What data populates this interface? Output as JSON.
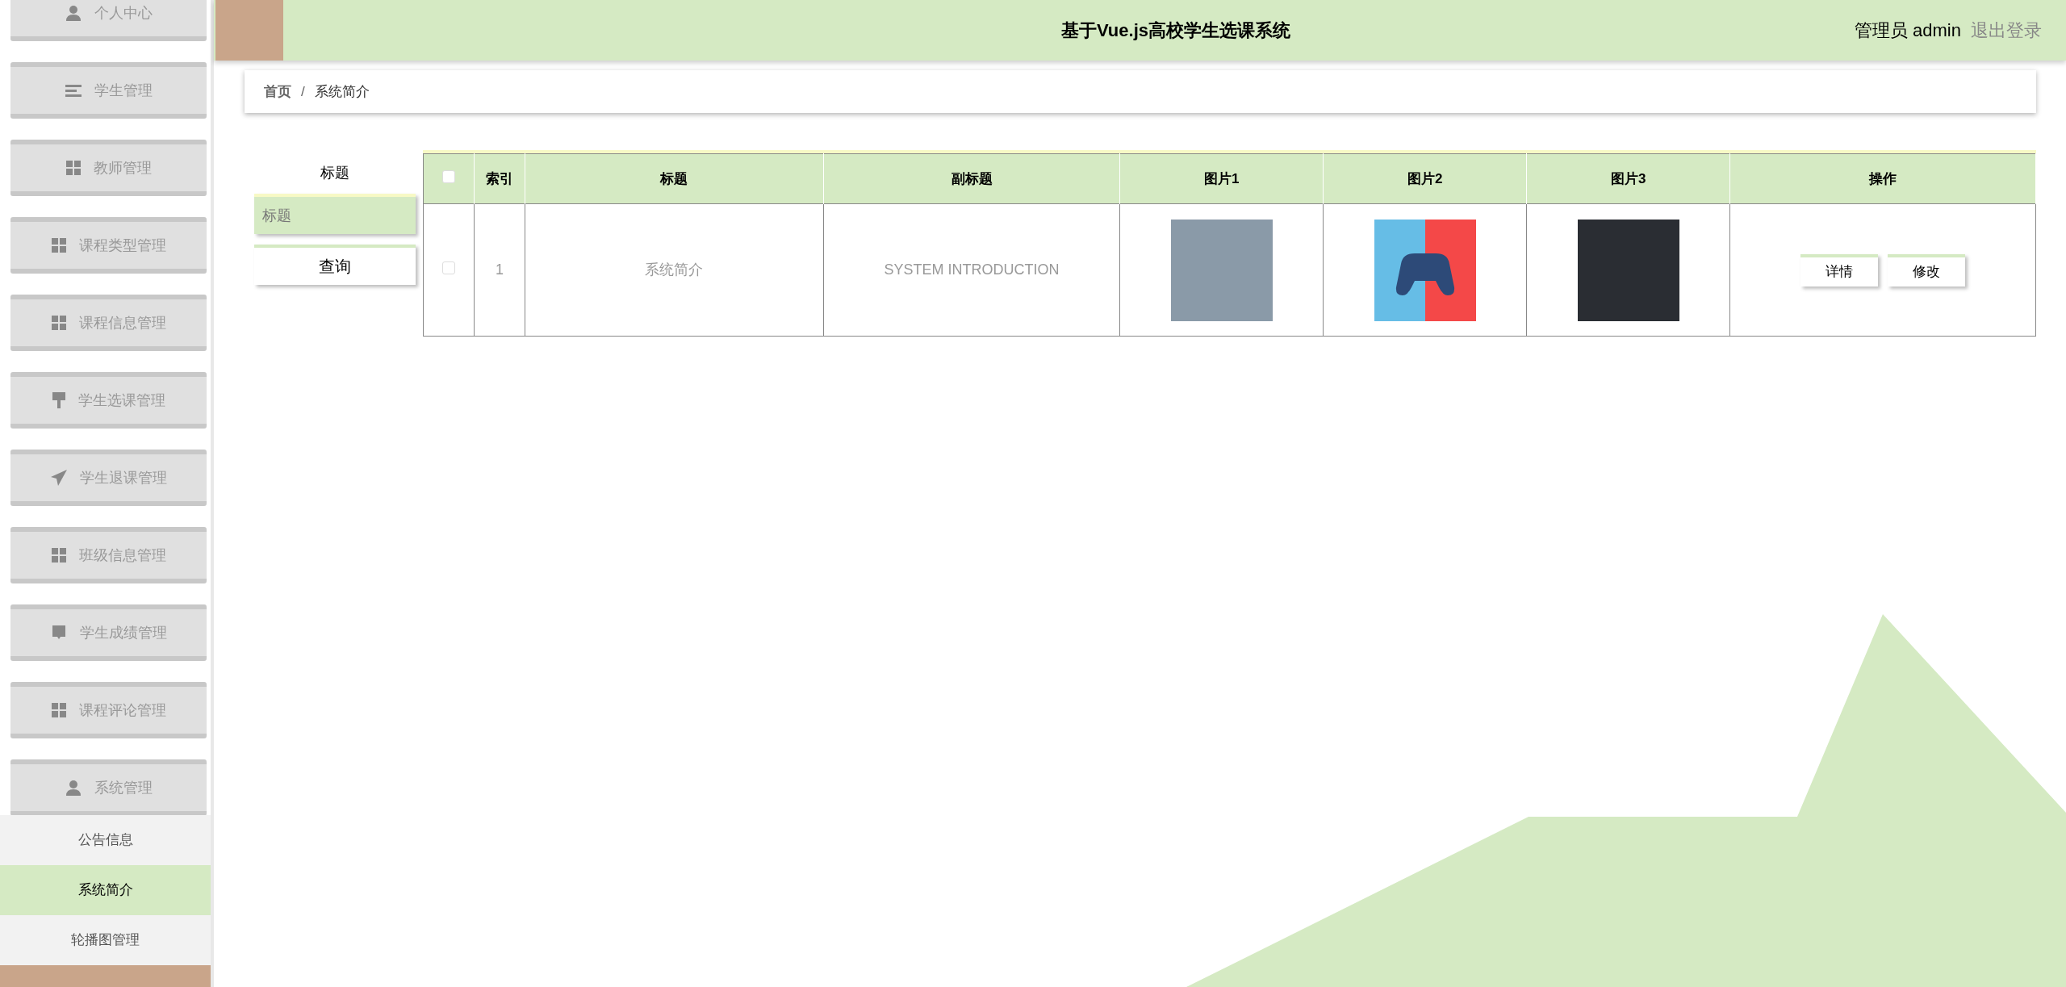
{
  "header": {
    "title": "基于Vue.js高校学生选课系统",
    "user": "管理员 admin",
    "logout": "退出登录"
  },
  "sidebar": {
    "items": [
      {
        "label": "个人中心",
        "kind": "user"
      },
      {
        "label": "学生管理",
        "kind": "list"
      },
      {
        "label": "教师管理",
        "kind": "grid"
      },
      {
        "label": "课程类型管理",
        "kind": "grid"
      },
      {
        "label": "课程信息管理",
        "kind": "grid"
      },
      {
        "label": "学生选课管理",
        "kind": "brush"
      },
      {
        "label": "学生退课管理",
        "kind": "plane"
      },
      {
        "label": "班级信息管理",
        "kind": "grid"
      },
      {
        "label": "学生成绩管理",
        "kind": "tray"
      },
      {
        "label": "课程评论管理",
        "kind": "grid"
      },
      {
        "label": "系统管理",
        "kind": "user"
      }
    ],
    "submenu": [
      {
        "label": "公告信息",
        "selected": false
      },
      {
        "label": "系统简介",
        "selected": true
      },
      {
        "label": "轮播图管理",
        "selected": false
      }
    ]
  },
  "breadcrumb": {
    "items": [
      "首页",
      "系统简介"
    ],
    "separator": "/"
  },
  "search": {
    "label": "标题",
    "placeholder": "标题",
    "button": "查询"
  },
  "table": {
    "all_checked": false,
    "columns": [
      "索引",
      "标题",
      "副标题",
      "图片1",
      "图片2",
      "图片3",
      "操作"
    ],
    "rows": [
      {
        "checked": false,
        "cells": [
          "1",
          "系统简介",
          "SYSTEM INTRODUCTION"
        ],
        "images": [
          {
            "kind": "photo"
          },
          {
            "kind": "drawing"
          },
          {
            "kind": "photo"
          }
        ],
        "actions": [
          "详情",
          "修改"
        ]
      }
    ]
  }
}
